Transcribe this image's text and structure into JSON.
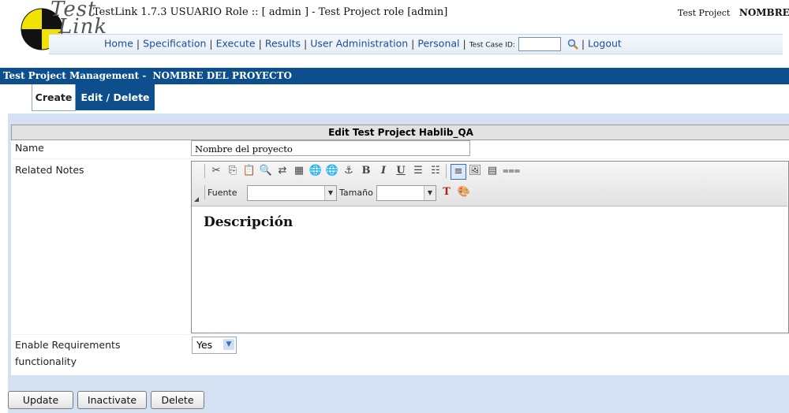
{
  "header": {
    "logo_word1": "Test",
    "logo_word2": "Link",
    "app_version": "TestLink 1.7.3",
    "user_label": "USUARIO",
    "role_text": "Role :: [ admin ] - Test Project role [admin]",
    "test_project_label": "Test Project",
    "test_project_value": "NOMBRE"
  },
  "menu": {
    "items": [
      "Home",
      "Specification",
      "Execute",
      "Results",
      "User Administration",
      "Personal"
    ],
    "testcase_label": "Test Case ID:",
    "testcase_value": "",
    "logout": "Logout"
  },
  "titlebar": {
    "prefix": "Test Project Management -",
    "project": "NOMBRE DEL PROYECTO"
  },
  "tabs": {
    "create": "Create",
    "edit": "Edit / Delete"
  },
  "form": {
    "header": "Edit Test Project Hablib_QA",
    "name_label": "Name",
    "name_value": "Nombre del proyecto",
    "notes_label": "Related Notes",
    "fuente_label": "Fuente",
    "tamano_label": "Tamaño",
    "editor_content": "Descripción",
    "req_label_1": "Enable Requirements",
    "req_label_2": "functionality",
    "req_value": "Yes"
  },
  "buttons": {
    "update": "Update",
    "inactivate": "Inactivate",
    "delete": "Delete"
  },
  "colors": {
    "brand_blue": "#0d4e8c",
    "panel_blue": "#d3e1f2",
    "link_blue": "#1a4e9a"
  }
}
